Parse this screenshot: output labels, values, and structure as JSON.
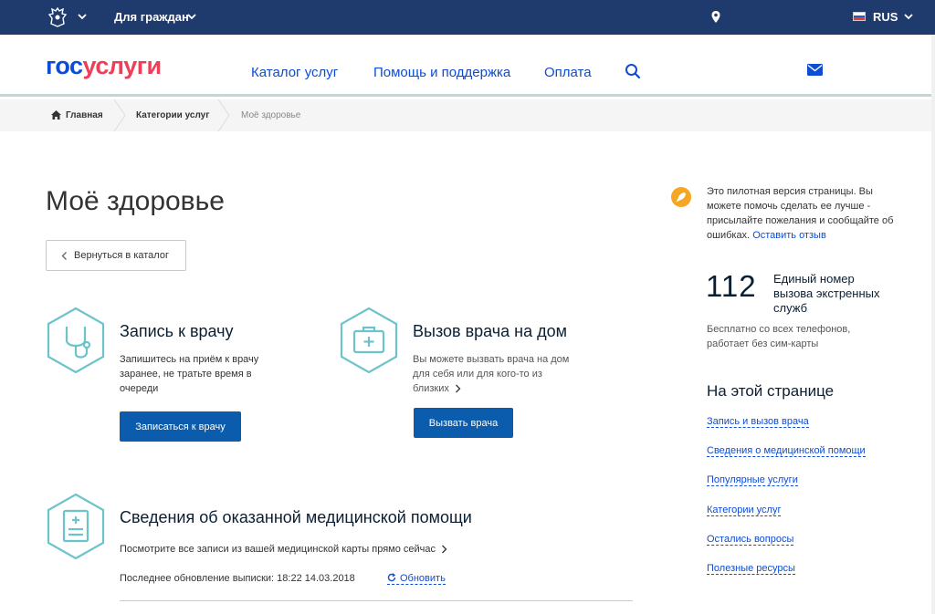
{
  "topbar": {
    "audience": "Для граждан",
    "lang": "RUS"
  },
  "header": {
    "logo_part1": "гос",
    "logo_part2": "услуги",
    "nav": [
      "Каталог услуг",
      "Помощь и поддержка",
      "Оплата"
    ]
  },
  "breadcrumb": {
    "home": "Главная",
    "categories": "Категории услуг",
    "current": "Моё здоровье"
  },
  "main": {
    "title": "Моё здоровье",
    "back_label": "Вернуться в каталог",
    "services": [
      {
        "title": "Запись к врачу",
        "desc_lines": [
          "Запишитесь на приём к врачу",
          "заранее, не тратьте время в",
          "очереди"
        ],
        "button": "Записаться к врачу"
      },
      {
        "title": "Вызов врача на дом",
        "desc_lines": [
          "Вы можете вызвать врача на дом",
          "для себя или для кого-то из",
          "близких"
        ],
        "button": "Вызвать врача"
      }
    ],
    "records": {
      "title": "Сведения об оказанной медицинской помощи",
      "desc": "Посмотрите все записи из вашей медицинской карты прямо сейчас",
      "update_label": "Последнее обновление выписки: 18:22 14.03.2018",
      "refresh": "Обновить"
    }
  },
  "sidebar": {
    "pilot_lines": [
      "Это пилотная версия страницы. Вы",
      "можете помочь сделать ее лучше -",
      "присылайте пожелания и сообщайте об",
      "ошибках."
    ],
    "pilot_link": "Оставить отзыв",
    "emergency_number": "112",
    "emergency_label_lines": [
      "Единый номер",
      "вызова экстренных",
      "служб"
    ],
    "emergency_note_lines": [
      "Бесплатно со всех телефонов,",
      "работает без сим-карты"
    ],
    "onpage_title": "На этой странице",
    "onpage_links": [
      "Запись и вызов врача",
      "Сведения о медицинской помощи",
      "Популярные услуги",
      "Категории услуг",
      "Остались вопросы",
      "Полезные ресурсы"
    ]
  },
  "colors": {
    "topbar": "#1f3a6d",
    "link": "#0d4cd3",
    "primary_button": "#0b5cad",
    "icon_teal": "#6cc3c9",
    "pilot_orange": "#f5a623"
  }
}
